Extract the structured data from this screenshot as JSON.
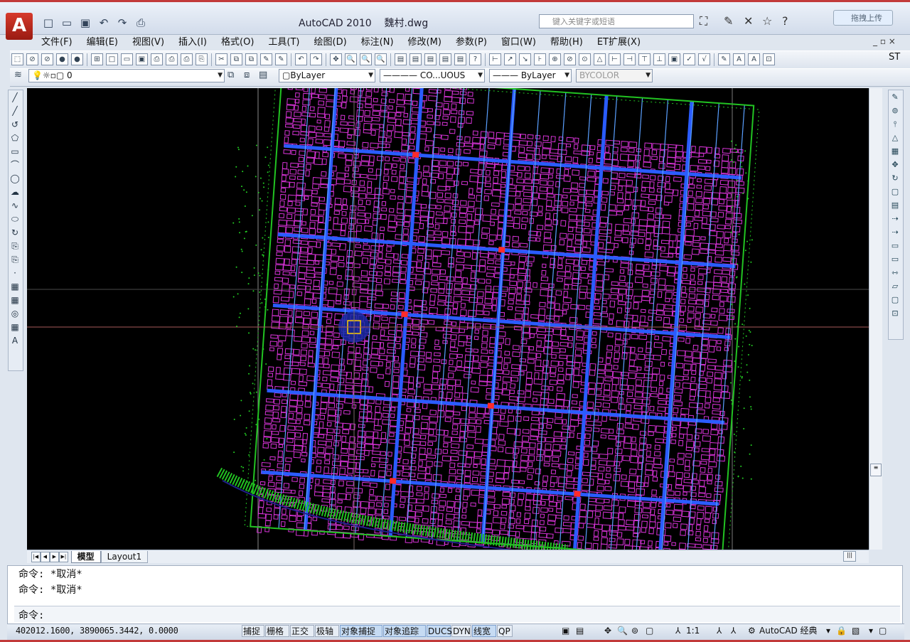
{
  "app": {
    "title": "AutoCAD 2010",
    "document": "魏村.dwg",
    "logo_glyph": "A",
    "search_placeholder": "键入关键字或短语",
    "upload_label": "拖拽上传",
    "quick_access": [
      "new-icon",
      "open-icon",
      "save-icon",
      "undo-icon",
      "redo-icon",
      "plot-icon"
    ],
    "window_controls": "_ ▫ ×"
  },
  "menu": [
    "文件(F)",
    "编辑(E)",
    "视图(V)",
    "插入(I)",
    "格式(O)",
    "工具(T)",
    "绘图(D)",
    "标注(N)",
    "修改(M)",
    "参数(P)",
    "窗口(W)",
    "帮助(H)",
    "ET扩展(X)"
  ],
  "toolbar_right_label": "ST",
  "properties": {
    "layer_value": "0",
    "color": "ByLayer",
    "linetype": "CO...UOUS",
    "lineweight": "ByLayer",
    "plotstyle": "BYCOLOR"
  },
  "tabs": {
    "model": "模型",
    "layout": "Layout1"
  },
  "command": {
    "history": [
      "命令: *取消*",
      "命令: *取消*"
    ],
    "prompt": "命令:"
  },
  "status": {
    "coordinates": "402012.1600, 3890065.3442, 0.0000",
    "toggles": [
      {
        "label": "捕捉",
        "on": false
      },
      {
        "label": "栅格",
        "on": false
      },
      {
        "label": "正交",
        "on": false
      },
      {
        "label": "极轴",
        "on": false
      },
      {
        "label": "对象捕捉",
        "on": true
      },
      {
        "label": "对象追踪",
        "on": true
      },
      {
        "label": "DUCS",
        "on": true
      },
      {
        "label": "DYN",
        "on": false
      },
      {
        "label": "线宽",
        "on": true
      },
      {
        "label": "QP",
        "on": false
      }
    ],
    "scale": "1:1",
    "workspace": "AutoCAD 经典"
  },
  "colors": {
    "canvas": "#000000",
    "buildings": "#d633d6",
    "roads": "#2a5cff",
    "greenery": "#22c322",
    "crosshair": "#a65a5a"
  }
}
